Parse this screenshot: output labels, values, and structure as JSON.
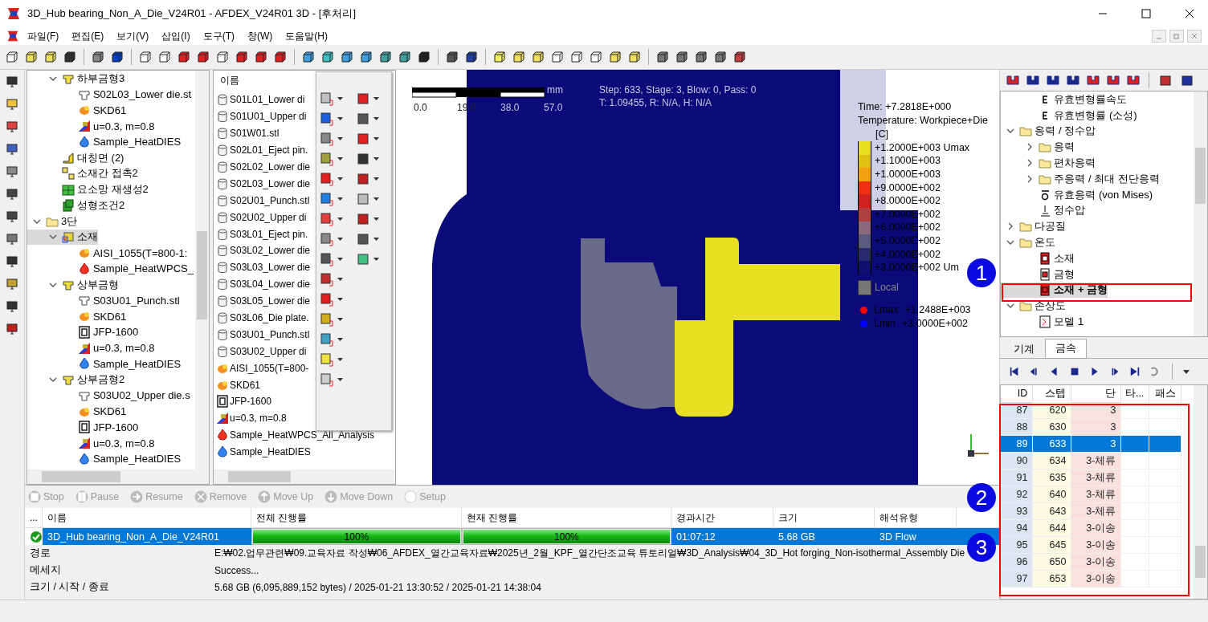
{
  "window": {
    "title": "3D_Hub bearing_Non_A_Die_V24R01 - AFDEX_V24R01 3D - [후처리]"
  },
  "menu": [
    "파일(F)",
    "편집(E)",
    "보기(V)",
    "삽입(I)",
    "도구(T)",
    "창(W)",
    "도움말(H)"
  ],
  "model_tree": [
    {
      "children": [
        {
          "label": "하부금형3",
          "kind": "die",
          "expanded": true,
          "selected": false,
          "children": [
            {
              "label": "S02L03_Lower die.st",
              "kind": "stl",
              "selected": false
            },
            {
              "label": "SKD61",
              "kind": "material",
              "selected": false
            },
            {
              "label": "u=0.3, m=0.8",
              "kind": "friction",
              "selected": false
            },
            {
              "label": "Sample_HeatDIES",
              "kind": "heat-die",
              "selected": false
            }
          ]
        },
        {
          "label": "대칭면 (2)",
          "kind": "symmetry",
          "selected": false
        },
        {
          "label": "소재간 접촉2",
          "kind": "contact",
          "selected": false
        },
        {
          "label": "요소망 재생성2",
          "kind": "remesh",
          "selected": false
        },
        {
          "label": "성형조건2",
          "kind": "condition",
          "selected": false
        }
      ]
    },
    {
      "label": "3단",
      "kind": "folder",
      "expanded": true,
      "selected": false,
      "children": [
        {
          "label": "소재",
          "kind": "workpiece",
          "expanded": true,
          "selected": true,
          "children": [
            {
              "label": "AISI_1055(T=800-1:",
              "kind": "material",
              "selected": false
            },
            {
              "label": "Sample_HeatWPCS_",
              "kind": "heat-wpcs",
              "selected": false
            }
          ]
        },
        {
          "label": "상부금형",
          "kind": "die",
          "expanded": true,
          "selected": false,
          "children": [
            {
              "label": "S03U01_Punch.stl",
              "kind": "stl",
              "selected": false
            },
            {
              "label": "SKD61",
              "kind": "material",
              "selected": false
            },
            {
              "label": "JFP-1600",
              "kind": "press",
              "selected": false
            },
            {
              "label": "u=0.3, m=0.8",
              "kind": "friction",
              "selected": false
            },
            {
              "label": "Sample_HeatDIES",
              "kind": "heat-die",
              "selected": false
            }
          ]
        },
        {
          "label": "상부금형2",
          "kind": "die",
          "expanded": true,
          "selected": false,
          "children": [
            {
              "label": "S03U02_Upper die.s",
              "kind": "stl",
              "selected": false
            },
            {
              "label": "SKD61",
              "kind": "material",
              "selected": false
            },
            {
              "label": "JFP-1600",
              "kind": "press",
              "selected": false
            },
            {
              "label": "u=0.3, m=0.8",
              "kind": "friction",
              "selected": false
            },
            {
              "label": "Sample_HeatDIES",
              "kind": "heat-die",
              "selected": false
            }
          ]
        }
      ]
    }
  ],
  "library": {
    "header": "이름",
    "items": [
      {
        "label": "S01L01_Lower di",
        "kind": "cylinder"
      },
      {
        "label": "S01U01_Upper di",
        "kind": "cylinder"
      },
      {
        "label": "S01W01.stl",
        "kind": "cylinder"
      },
      {
        "label": "S02L01_Eject pin.",
        "kind": "cylinder"
      },
      {
        "label": "S02L02_Lower die",
        "kind": "cylinder"
      },
      {
        "label": "S02L03_Lower die",
        "kind": "cylinder"
      },
      {
        "label": "S02U01_Punch.stl",
        "kind": "cylinder"
      },
      {
        "label": "S02U02_Upper di",
        "kind": "cylinder"
      },
      {
        "label": "S03L01_Eject pin.",
        "kind": "cylinder"
      },
      {
        "label": "S03L02_Lower die",
        "kind": "cylinder"
      },
      {
        "label": "S03L03_Lower die",
        "kind": "cylinder"
      },
      {
        "label": "S03L04_Lower die",
        "kind": "cylinder"
      },
      {
        "label": "S03L05_Lower die",
        "kind": "cylinder"
      },
      {
        "label": "S03L06_Die plate.",
        "kind": "cylinder"
      },
      {
        "label": "S03U01_Punch.stl",
        "kind": "cylinder"
      },
      {
        "label": "S03U02_Upper di",
        "kind": "cylinder"
      },
      {
        "label": "AISI_1055(T=800-",
        "kind": "material"
      },
      {
        "label": "SKD61",
        "kind": "material"
      },
      {
        "label": "JFP-1600",
        "kind": "press"
      },
      {
        "label": "u=0.3, m=0.8",
        "kind": "friction"
      },
      {
        "label": "Sample_HeatWPCS_All_Analysis",
        "kind": "heat-wpcs"
      },
      {
        "label": "Sample_HeatDIES",
        "kind": "heat-die"
      }
    ]
  },
  "viewport": {
    "scale": {
      "unit": "mm",
      "ticks": [
        "0.0",
        "19.0",
        "38.0",
        "57.0"
      ]
    },
    "info": [
      "Step: 633, Stage: 3, Blow: 0, Pass: 0",
      "T: 1.09455, R: N/A, H: N/A"
    ],
    "legend": {
      "time": "Time: +7.2818E+000",
      "quantity": "Temperature: Workpiece+Die",
      "unit": "[C]",
      "bands": [
        {
          "label": "+1.2000E+003 Umax",
          "color": "#e8e020"
        },
        {
          "label": "+1.1000E+003",
          "color": "#e0c010"
        },
        {
          "label": "+1.0000E+003",
          "color": "#f0a010"
        },
        {
          "label": "+9.0000E+002",
          "color": "#f03010"
        },
        {
          "label": "+8.0000E+002",
          "color": "#d02020"
        },
        {
          "label": "+7.0000E+002",
          "color": "#b04040"
        },
        {
          "label": "+6.0000E+002",
          "color": "#8a6a7a"
        },
        {
          "label": "+5.0000E+002",
          "color": "#5a5a80"
        },
        {
          "label": "+4.0000E+002",
          "color": "#2a2a70"
        },
        {
          "label": "+3.0000E+002 Um",
          "color": "#101070"
        }
      ],
      "local": "Local",
      "extremes": [
        {
          "name": "Lmax",
          "value": "+1.2488E+003",
          "color": "#ff0000"
        },
        {
          "name": "Lmin",
          "value": "+3.0000E+002",
          "color": "#0000ff"
        }
      ]
    }
  },
  "result_tree": [
    {
      "children": [
        {
          "label": "유효변형률속도",
          "kind": "rate",
          "selected": false
        },
        {
          "label": "유효변형률 (소성)",
          "kind": "strain",
          "selected": false
        }
      ]
    },
    {
      "label": "응력 / 정수압",
      "kind": "folder",
      "expanded": true,
      "selected": false,
      "children": [
        {
          "label": "응력",
          "kind": "folder",
          "expanded": false,
          "selected": false
        },
        {
          "label": "편차응력",
          "kind": "folder",
          "expanded": false,
          "selected": false
        },
        {
          "label": "주응력 / 최대 전단응력",
          "kind": "folder",
          "expanded": false,
          "selected": false
        },
        {
          "label": "유효응력 (von Mises)",
          "kind": "stress",
          "selected": false
        },
        {
          "label": "정수압",
          "kind": "pressure",
          "selected": false
        }
      ]
    },
    {
      "label": "다공질",
      "kind": "folder",
      "expanded": false,
      "selected": false
    },
    {
      "label": "온도",
      "kind": "folder",
      "expanded": true,
      "selected": false,
      "children": [
        {
          "label": "소재",
          "kind": "temp-wp",
          "selected": false
        },
        {
          "label": "금형",
          "kind": "temp-die",
          "selected": false
        },
        {
          "label": "소재 + 금형",
          "kind": "temp-all",
          "selected": true
        }
      ]
    },
    {
      "label": "손상도",
      "kind": "folder",
      "expanded": true,
      "selected": false,
      "children": [
        {
          "label": "모델 1",
          "kind": "damage",
          "selected": false
        }
      ]
    }
  ],
  "result_tabs": [
    {
      "label": "기계",
      "selected": false
    },
    {
      "label": "금속",
      "selected": true
    }
  ],
  "steps": {
    "columns": [
      "ID",
      "스텝",
      "단",
      "타...",
      "패스"
    ],
    "rows": [
      {
        "id": "87",
        "step": "620",
        "stage": "3",
        "selected": false
      },
      {
        "id": "88",
        "step": "630",
        "stage": "3",
        "selected": false
      },
      {
        "id": "89",
        "step": "633",
        "stage": "3",
        "selected": true
      },
      {
        "id": "90",
        "step": "634",
        "stage": "3-체류",
        "selected": false
      },
      {
        "id": "91",
        "step": "635",
        "stage": "3-체류",
        "selected": false
      },
      {
        "id": "92",
        "step": "640",
        "stage": "3-체류",
        "selected": false
      },
      {
        "id": "93",
        "step": "643",
        "stage": "3-체류",
        "selected": false
      },
      {
        "id": "94",
        "step": "644",
        "stage": "3-이송",
        "selected": false
      },
      {
        "id": "95",
        "step": "645",
        "stage": "3-이송",
        "selected": false
      },
      {
        "id": "96",
        "step": "650",
        "stage": "3-이송",
        "selected": false
      },
      {
        "id": "97",
        "step": "653",
        "stage": "3-이송",
        "selected": false
      }
    ]
  },
  "jobs": {
    "actions": [
      {
        "label": "Stop",
        "kind": "stop",
        "disabled": true
      },
      {
        "label": "Pause",
        "kind": "pause",
        "disabled": true
      },
      {
        "label": "Resume",
        "kind": "resume",
        "disabled": true
      },
      {
        "label": "Remove",
        "kind": "remove",
        "disabled": true
      },
      {
        "label": "Move Up",
        "kind": "up",
        "disabled": true
      },
      {
        "label": "Move Down",
        "kind": "down",
        "disabled": true
      },
      {
        "label": "Setup",
        "kind": "setup",
        "disabled": true
      }
    ],
    "columns": [
      "...",
      "이름",
      "전체 진행률",
      "현재 진행률",
      "경과시간",
      "크기",
      "해석유형"
    ],
    "rows": [
      {
        "done": true,
        "selected": true,
        "name": "3D_Hub bearing_Non_A_Die_V24R01",
        "overall": {
          "level": 1,
          "label": "100%"
        },
        "current": {
          "level": 1,
          "label": "100%"
        },
        "elapsed": "01:07:12",
        "size": "5.68 GB",
        "type": "3D Flow"
      }
    ],
    "details": [
      {
        "label": "경로",
        "value": "E:₩02.업무관련₩09.교육자료 작성₩06_AFDEX_열간교육자료₩2025년_2월_KPF_열간단조교육 튜토리얼₩3D_Analysis₩04_3D_Hot forging_Non-isothermal_Assembly Die"
      },
      {
        "label": "메세지",
        "value": "Success..."
      },
      {
        "label": "크기 / 시작 / 종료",
        "value": "5.68 GB (6,095,889,152 bytes) / 2025-01-21 13:30:52 / 2025-01-21 14:38:04"
      }
    ]
  },
  "markers": [
    "1",
    "2",
    "3"
  ]
}
